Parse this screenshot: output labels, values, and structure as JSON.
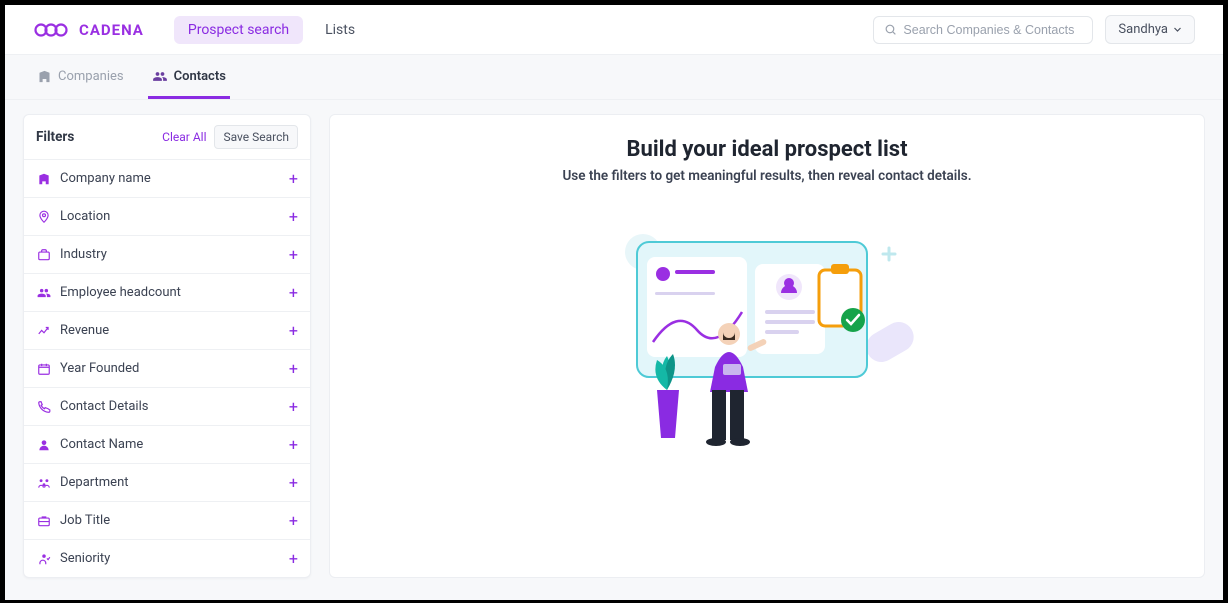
{
  "brand": {
    "name": "CADENA"
  },
  "nav": {
    "prospect_search": "Prospect search",
    "lists": "Lists"
  },
  "search": {
    "placeholder": "Search Companies & Contacts"
  },
  "user": {
    "name": "Sandhya"
  },
  "tabs": {
    "companies": "Companies",
    "contacts": "Contacts"
  },
  "filters": {
    "title": "Filters",
    "clear_all": "Clear All",
    "save_search": "Save Search",
    "items": [
      {
        "label": "Company name",
        "icon": "building-icon"
      },
      {
        "label": "Location",
        "icon": "location-icon"
      },
      {
        "label": "Industry",
        "icon": "briefcase-icon"
      },
      {
        "label": "Employee headcount",
        "icon": "people-icon"
      },
      {
        "label": "Revenue",
        "icon": "trend-icon"
      },
      {
        "label": "Year Founded",
        "icon": "calendar-icon"
      },
      {
        "label": "Contact Details",
        "icon": "phone-icon"
      },
      {
        "label": "Contact Name",
        "icon": "person-icon"
      },
      {
        "label": "Department",
        "icon": "dept-icon"
      },
      {
        "label": "Job Title",
        "icon": "jobtitle-icon"
      },
      {
        "label": "Seniority",
        "icon": "seniority-icon"
      }
    ]
  },
  "main": {
    "title": "Build your ideal prospect list",
    "subtitle": "Use the filters to get meaningful results, then reveal contact details."
  }
}
